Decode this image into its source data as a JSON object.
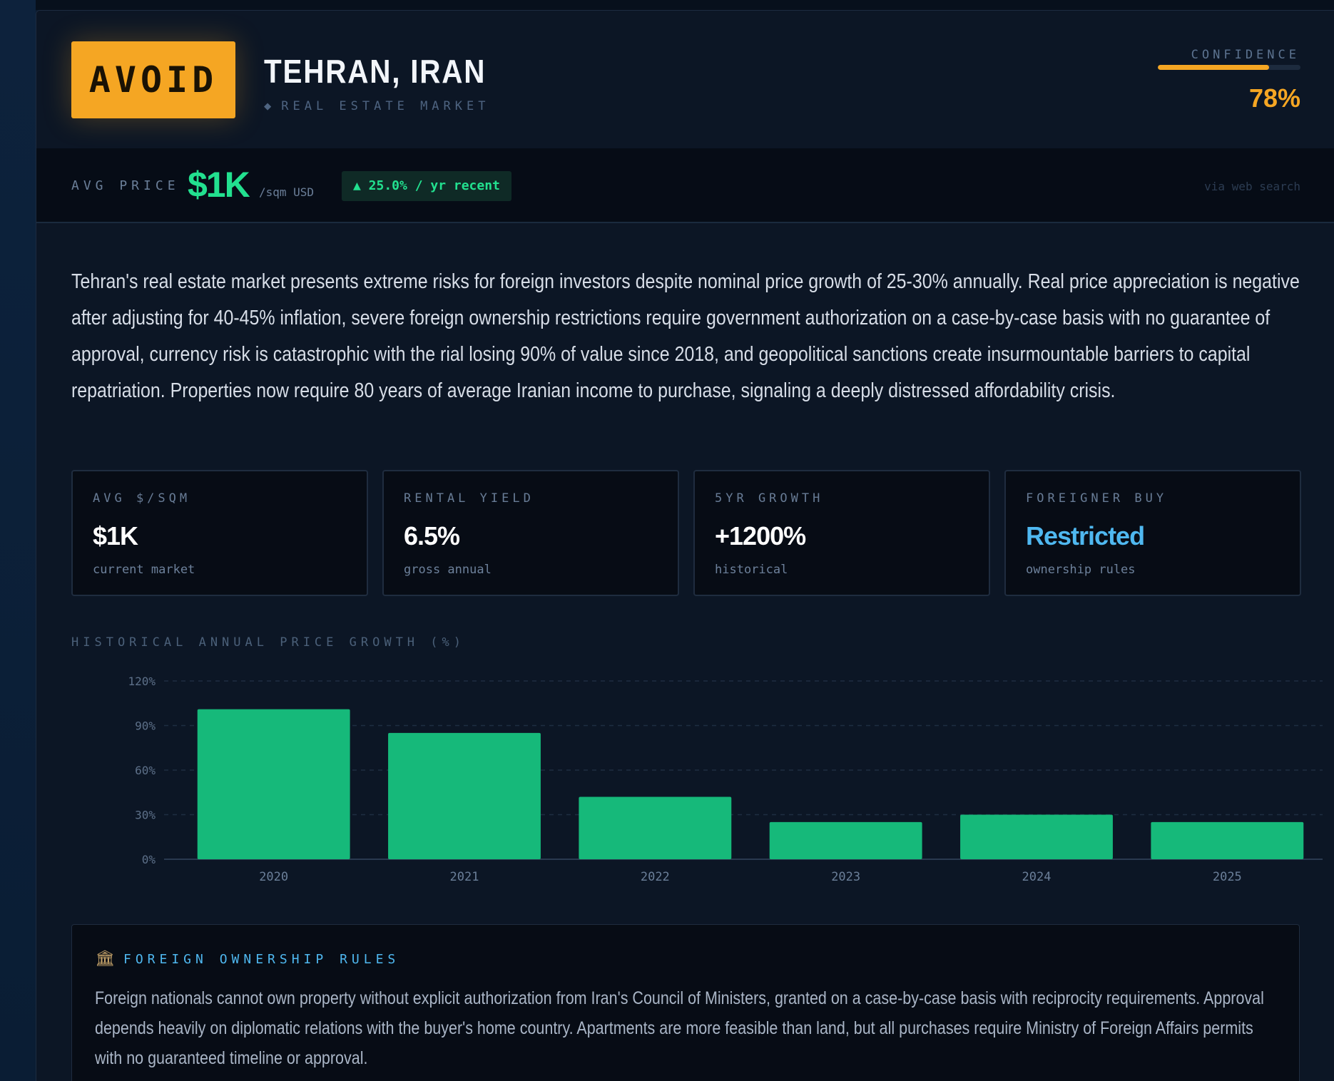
{
  "header": {
    "verdict": "AVOID",
    "city": "TEHRAN, IRAN",
    "subtitle": "REAL ESTATE MARKET",
    "subtitle_icon": "diamond-icon",
    "confidence_label": "CONFIDENCE",
    "confidence_value": "78%",
    "confidence_fraction": 0.78
  },
  "price_bar": {
    "label": "AVG PRICE",
    "value": "$1K",
    "unit": "/sqm USD",
    "trend": "▲ 25.0% / yr recent",
    "source": "via web search"
  },
  "summary": "Tehran's real estate market presents extreme risks for foreign investors despite nominal price growth of 25-30% annually. Real price appreciation is negative after adjusting for 40-45% inflation, severe foreign ownership restrictions require government authorization on a case-by-case basis with no guarantee of approval, currency risk is catastrophic with the rial losing 90% of value since 2018, and geopolitical sanctions create insurmountable barriers to capital repatriation. Properties now require 80 years of average Iranian income to purchase, signaling a deeply distressed affordability crisis.",
  "stats": [
    {
      "label": "AVG $/SQM",
      "value": "$1K",
      "sub": "current market"
    },
    {
      "label": "RENTAL YIELD",
      "value": "6.5%",
      "sub": "gross annual"
    },
    {
      "label": "5YR GROWTH",
      "value": "+1200%",
      "sub": "historical"
    },
    {
      "label": "FOREIGNER BUY",
      "value": "Restricted",
      "sub": "ownership rules"
    }
  ],
  "chart_title": "HISTORICAL ANNUAL PRICE GROWTH (%)",
  "chart_data": {
    "type": "bar",
    "categories": [
      "2020",
      "2021",
      "2022",
      "2023",
      "2024",
      "2025"
    ],
    "values": [
      101,
      85,
      42,
      25,
      30,
      25
    ],
    "ylim": [
      0,
      120
    ],
    "yticks": [
      "0%",
      "30%",
      "60%",
      "90%",
      "120%"
    ],
    "ytick_values": [
      0,
      30,
      60,
      90,
      120
    ],
    "grid": true,
    "bar_color": "#16b97a"
  },
  "rules": {
    "icon": "bank-icon",
    "title": "FOREIGN OWNERSHIP RULES",
    "text": "Foreign nationals cannot own property without explicit authorization from Iran's Council of Ministers, granted on a case-by-case basis with reciprocity requirements. Approval depends heavily on diplomatic relations with the buyer's home country. Apartments are more feasible than land, but all purchases require Ministry of Foreign Affairs permits with no guaranteed timeline or approval."
  },
  "colors": {
    "accent": "#f5a623",
    "positive": "#22e08f",
    "info": "#4fb8f0",
    "background": "#0c1625"
  }
}
